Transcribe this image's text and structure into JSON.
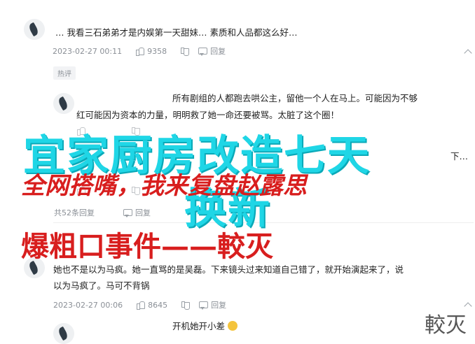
{
  "comments": [
    {
      "text": "…  我看三石弟弟才是内娱第一天甜妹… 素质和人品都这么好…",
      "time": "2023-02-27 00:11",
      "likes": "9358",
      "reply": "回复",
      "tag": "热评"
    },
    {
      "text_line1": "所有剧组的人都跑去哄公主，留他一个人在马上。可能因为不够",
      "text_line2": "红可能因为资本的力量，明明救了她一命还要被骂。太脏了这个圈！"
    },
    {
      "partial_text": "下…",
      "replies_count": "共52条回复",
      "reply": "回复"
    },
    {
      "text_line1": "她也不是以为马疯。她一直骂的是吴磊。下来镜头过来知道自己错了，就开始演起来了，说",
      "text_line2": "以为马疯了。马可不背锅",
      "time": "2023-02-27 00:06",
      "likes": "8645",
      "reply": "回复"
    },
    {
      "text": "开机她开小差"
    }
  ],
  "overlay": {
    "cyan_line1": "宜家厨房改造七天",
    "cyan_line2": "换新",
    "red_line1": "全网搭嘴，我来复盘赵露思",
    "red_line2": "爆粗口事件——較灭"
  },
  "watermark": "較灭",
  "colors": {
    "cyan": "#1fd6e6",
    "red": "#d81e1e",
    "meta": "#8a8f96"
  }
}
